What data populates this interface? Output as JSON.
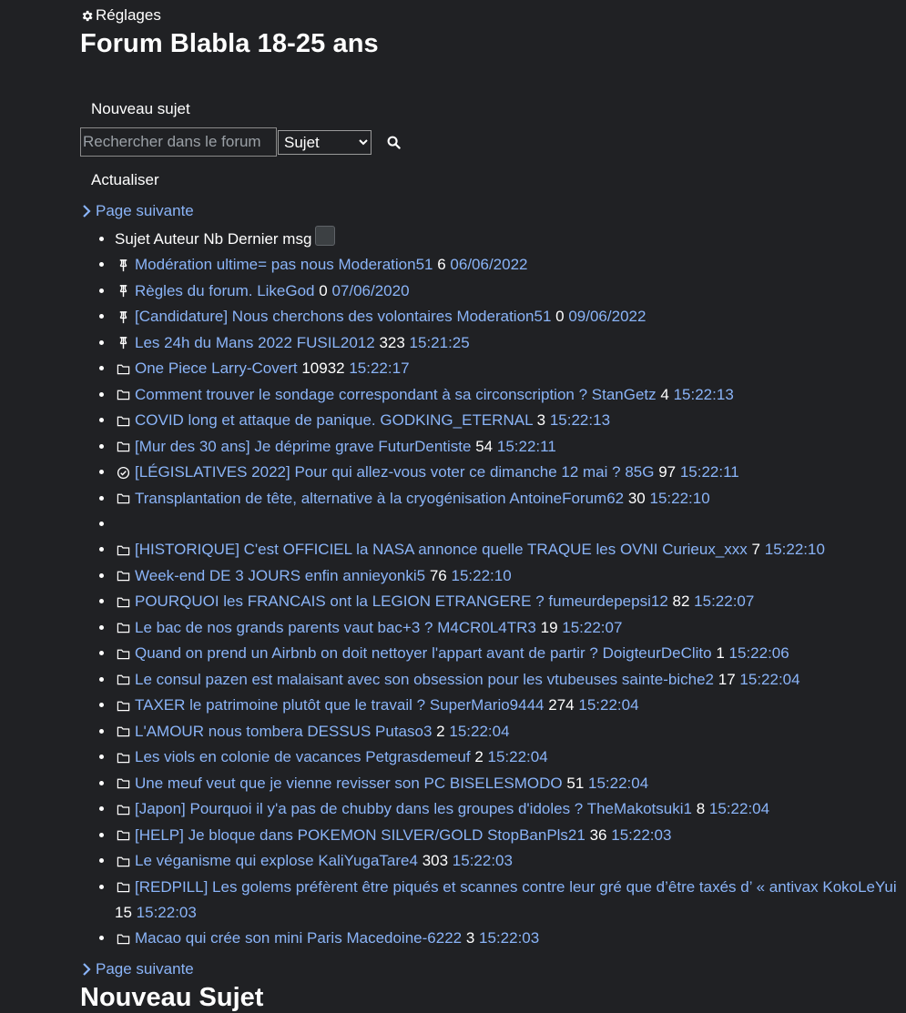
{
  "header": {
    "settings_label": "Réglages",
    "title": "Forum Blabla 18-25 ans"
  },
  "actions": {
    "new_topic": "Nouveau sujet",
    "search_placeholder": "Rechercher dans le forum",
    "search_scope": "Sujet",
    "refresh": "Actualiser"
  },
  "pagination": {
    "next_top": "Page suivante",
    "next_bottom": "Page suivante"
  },
  "table_header": {
    "subject": "Sujet",
    "author": "Auteur",
    "nb": "Nb",
    "last": "Dernier msg"
  },
  "topics": [
    {
      "icon": "pin-icon",
      "subject": "Modération ultime= pas nous",
      "author": "Moderation51",
      "count": "6",
      "last": "06/06/2022"
    },
    {
      "icon": "pin-icon",
      "subject": "Règles du forum.",
      "author": "LikeGod",
      "count": "0",
      "last": "07/06/2020"
    },
    {
      "icon": "pin-icon",
      "subject": "[Candidature] Nous cherchons des volontaires",
      "author": "Moderation51",
      "count": "0",
      "last": "09/06/2022"
    },
    {
      "icon": "pin-icon",
      "subject": "Les 24h du Mans 2022",
      "author": "FUSIL2012",
      "count": "323",
      "last": "15:21:25"
    },
    {
      "icon": "folder-icon",
      "subject": "One Piece",
      "author": "Larry-Covert",
      "count": "10932",
      "last": "15:22:17"
    },
    {
      "icon": "folder-icon",
      "subject": "Comment trouver le sondage correspondant à sa circonscription ?",
      "author": "StanGetz",
      "count": "4",
      "last": "15:22:13"
    },
    {
      "icon": "folder-icon",
      "subject": "COVID long et attaque de panique.",
      "author": "GODKING_ETERNAL",
      "count": "3",
      "last": "15:22:13"
    },
    {
      "icon": "folder-icon",
      "subject": "[Mur des 30 ans] Je déprime grave",
      "author": "FuturDentiste",
      "count": "54",
      "last": "15:22:11"
    },
    {
      "icon": "check-circle-icon",
      "subject": "[LÉGISLATIVES 2022] Pour qui allez-vous voter ce dimanche 12 mai ?",
      "author": "85G",
      "count": "97",
      "last": "15:22:11"
    },
    {
      "icon": "folder-icon",
      "subject": "Transplantation de tête, alternative à la cryogénisation",
      "author": "AntoineForum62",
      "count": "30",
      "last": "15:22:10"
    },
    {
      "icon": "",
      "subject": "",
      "author": "",
      "count": "",
      "last": ""
    },
    {
      "icon": "folder-icon",
      "subject": "[HISTORIQUE] C'est OFFICIEL la NASA annonce quelle TRAQUE les OVNI",
      "author": "Curieux_xxx",
      "count": "7",
      "last": "15:22:10"
    },
    {
      "icon": "folder-icon",
      "subject": "Week-end DE 3 JOURS enfin",
      "author": "annieyonki5",
      "count": "76",
      "last": "15:22:10"
    },
    {
      "icon": "folder-icon",
      "subject": "POURQUOI les FRANCAIS ont la LEGION ETRANGERE ?",
      "author": "fumeurdepepsi12",
      "count": "82",
      "last": "15:22:07"
    },
    {
      "icon": "folder-icon",
      "subject": "Le bac de nos grands parents vaut bac+3 ?",
      "author": "M4CR0L4TR3",
      "count": "19",
      "last": "15:22:07"
    },
    {
      "icon": "folder-icon",
      "subject": "Quand on prend un Airbnb on doit nettoyer l'appart avant de partir ?",
      "author": "DoigteurDeClito",
      "count": "1",
      "last": "15:22:06"
    },
    {
      "icon": "folder-icon",
      "subject": "Le consul pazen est malaisant avec son obsession pour les vtubeuses",
      "author": "sainte-biche2",
      "count": "17",
      "last": "15:22:04"
    },
    {
      "icon": "folder-icon",
      "subject": "TAXER le patrimoine plutôt que le travail ?",
      "author": "SuperMario9444",
      "count": "274",
      "last": "15:22:04"
    },
    {
      "icon": "folder-icon",
      "subject": "L'AMOUR nous tombera DESSUS",
      "author": "Putaso3",
      "count": "2",
      "last": "15:22:04"
    },
    {
      "icon": "folder-icon",
      "subject": "Les viols en colonie de vacances",
      "author": "Petgrasdemeuf",
      "count": "2",
      "last": "15:22:04"
    },
    {
      "icon": "folder-icon",
      "subject": "Une meuf veut que je vienne revisser son PC",
      "author": "BISELESMODO",
      "count": "51",
      "last": "15:22:04"
    },
    {
      "icon": "folder-icon",
      "subject": "[Japon] Pourquoi il y'a pas de chubby dans les groupes d'idoles ?",
      "author": "TheMakotsuki1",
      "count": "8",
      "last": "15:22:04"
    },
    {
      "icon": "folder-icon",
      "subject": "[HELP] Je bloque dans POKEMON SILVER/GOLD",
      "author": "StopBanPls21",
      "count": "36",
      "last": "15:22:03"
    },
    {
      "icon": "folder-icon",
      "subject": "Le véganisme qui explose",
      "author": "KaliYugaTare4",
      "count": "303",
      "last": "15:22:03"
    },
    {
      "icon": "folder-icon",
      "subject": "[REDPILL] Les golems préfèrent être piqués et scannes contre leur gré que d’être taxés d’ « antivax",
      "author": "KokoLeYui",
      "count": "15",
      "last": "15:22:03"
    },
    {
      "icon": "folder-icon",
      "subject": "Macao qui crée son mini Paris",
      "author": "Macedoine-6222",
      "count": "3",
      "last": "15:22:03"
    }
  ],
  "footer": {
    "new_topic_heading": "Nouveau Sujet"
  }
}
